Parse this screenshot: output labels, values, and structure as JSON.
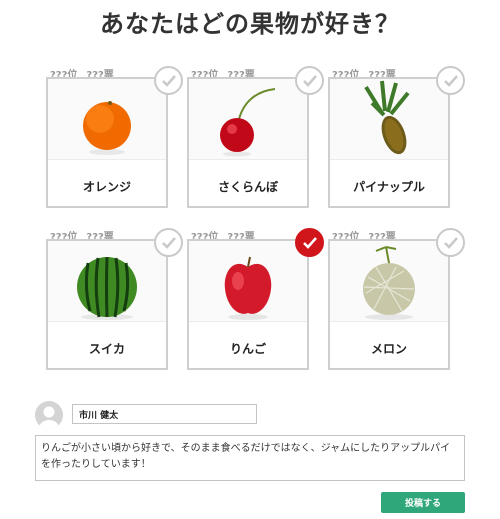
{
  "title": "あなたはどの果物が好き？",
  "rank_placeholder": "???位",
  "votes_placeholder": "???票",
  "fruits": [
    {
      "name": "オレンジ",
      "icon": "orange-icon",
      "selected": false
    },
    {
      "name": "さくらんぼ",
      "icon": "cherry-icon",
      "selected": false
    },
    {
      "name": "パイナップル",
      "icon": "pineapple-icon",
      "selected": false
    },
    {
      "name": "スイカ",
      "icon": "watermelon-icon",
      "selected": false
    },
    {
      "name": "りんご",
      "icon": "apple-icon",
      "selected": true
    },
    {
      "name": "メロン",
      "icon": "melon-icon",
      "selected": false
    }
  ],
  "form": {
    "name_value": "市川 健太",
    "comment_value": "りんごが小さい頃から好きで、そのまま食べるだけではなく、ジャムにしたりアップルパイを作ったりしています！",
    "submit_label": "投稿する"
  },
  "colors": {
    "selected": "#d0161b",
    "submit": "#2fa77a",
    "border": "#cfcfcf"
  }
}
